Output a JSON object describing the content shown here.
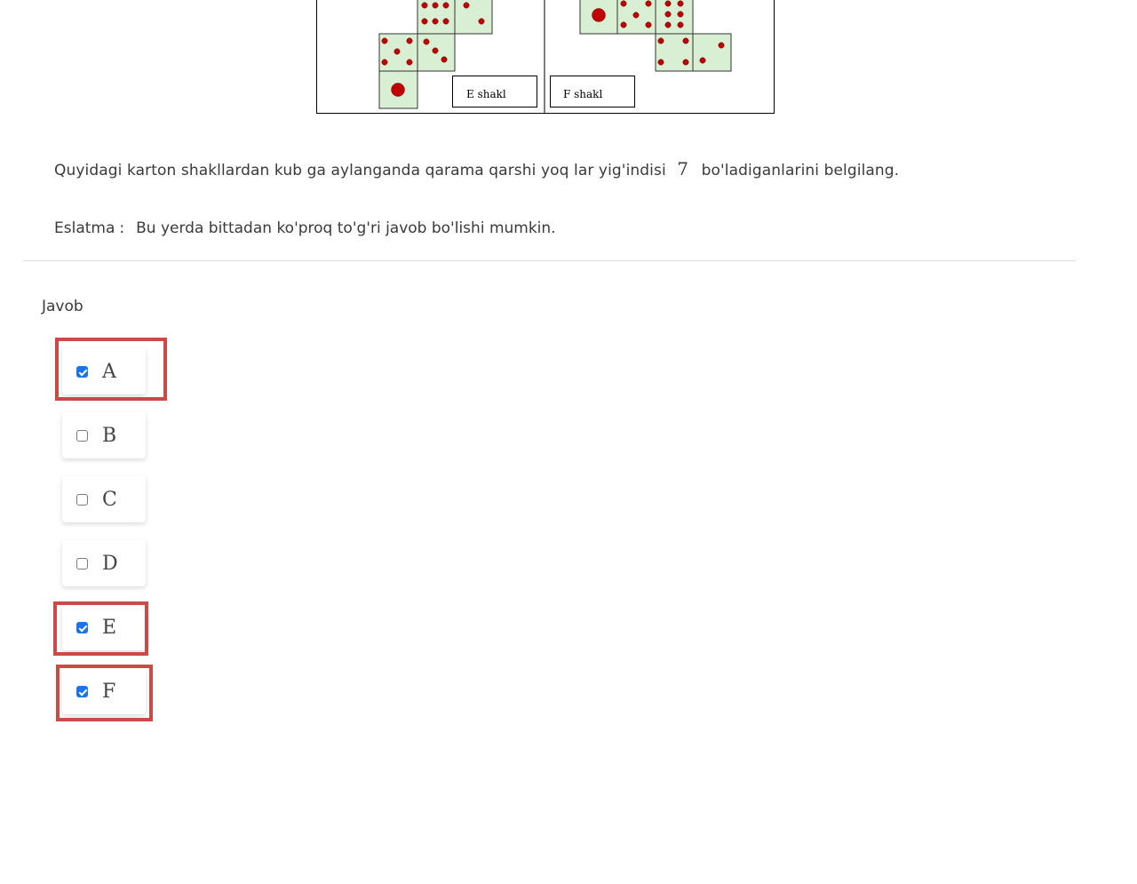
{
  "figure": {
    "e_label": "E shakl",
    "f_label": "F shakl"
  },
  "question": {
    "text_before": "Quyidagi karton shakllardan kub ga aylanganda qarama qarshi yoq lar yig'indisi",
    "number": "7",
    "text_after": "bo'ladiganlarini belgilang."
  },
  "note": {
    "label": "Eslatma",
    "colon": ":",
    "text": "Bu yerda bittadan ko'proq to'g'ri javob bo'lishi mumkin."
  },
  "answer": {
    "label": "Javob",
    "options": [
      {
        "label": "A",
        "checked": true,
        "highlighted": true
      },
      {
        "label": "B",
        "checked": false,
        "highlighted": false
      },
      {
        "label": "C",
        "checked": false,
        "highlighted": false
      },
      {
        "label": "D",
        "checked": false,
        "highlighted": false
      },
      {
        "label": "E",
        "checked": true,
        "highlighted": true
      },
      {
        "label": "F",
        "checked": true,
        "highlighted": true
      }
    ]
  },
  "colors": {
    "highlight": "#cc4a45",
    "checkbox_checked": "#1a73e8",
    "die_face": "#d9efd4",
    "pip": "#c00000"
  }
}
